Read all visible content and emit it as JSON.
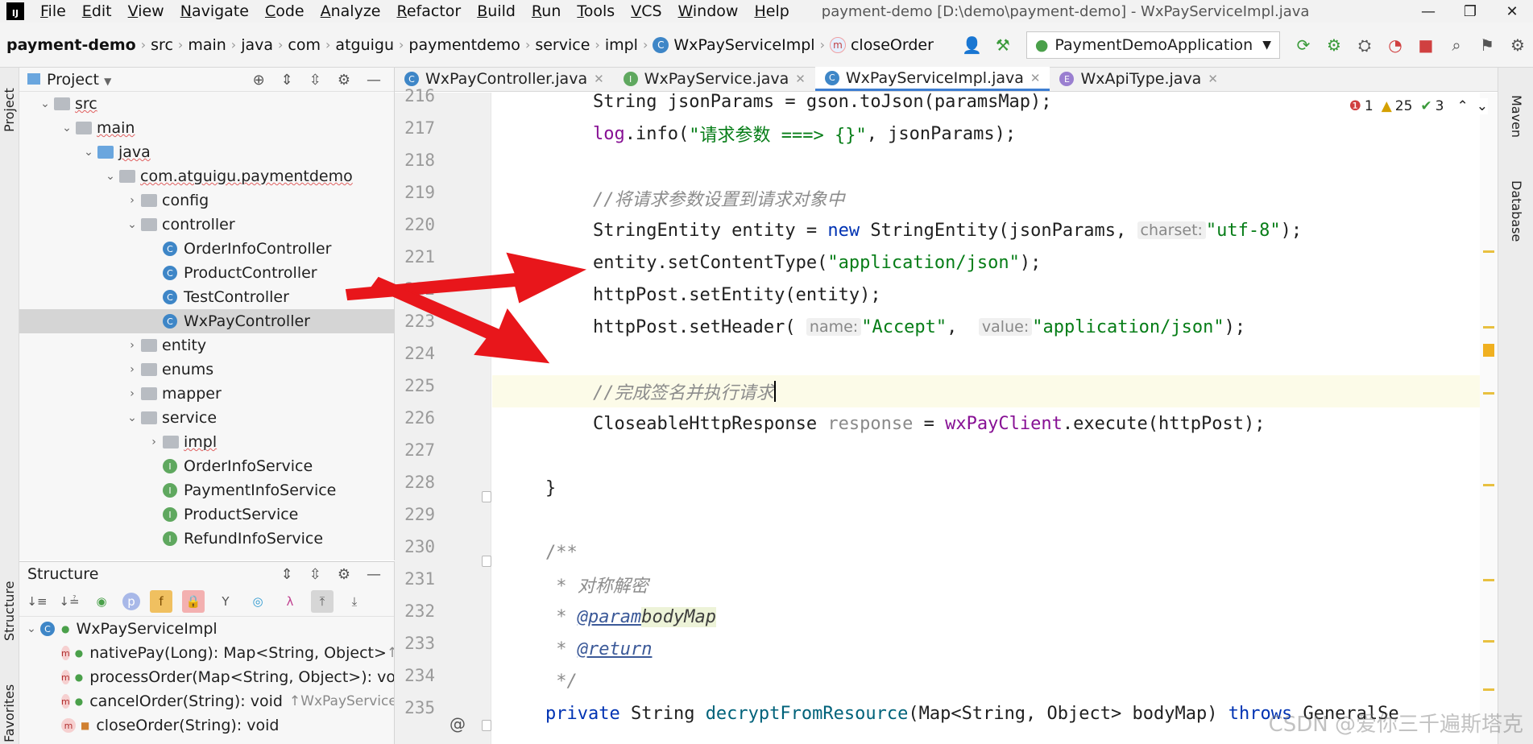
{
  "menubar": {
    "logo": "IJ",
    "items": [
      "File",
      "Edit",
      "View",
      "Navigate",
      "Code",
      "Analyze",
      "Refactor",
      "Build",
      "Run",
      "Tools",
      "VCS",
      "Window",
      "Help"
    ],
    "window_title": "payment-demo [D:\\demo\\payment-demo] - WxPayServiceImpl.java",
    "controls": [
      "—",
      "❐",
      "✕"
    ]
  },
  "breadcrumb": {
    "items": [
      "payment-demo",
      "src",
      "main",
      "java",
      "com",
      "atguigu",
      "paymentdemo",
      "service",
      "impl",
      "WxPayServiceImpl",
      "closeOrder"
    ]
  },
  "run_config": {
    "label": "PaymentDemoApplication"
  },
  "left_stripe": {
    "project": "Project",
    "structure": "Structure",
    "favorites": "Favorites"
  },
  "right_stripe": {
    "maven": "Maven",
    "database": "Database"
  },
  "project_panel": {
    "title": "Project",
    "tree": [
      {
        "label": "src",
        "indent": 1,
        "type": "folder",
        "open": true
      },
      {
        "label": "main",
        "indent": 2,
        "type": "folder",
        "open": true
      },
      {
        "label": "java",
        "indent": 3,
        "type": "folder-blue",
        "open": true
      },
      {
        "label": "com.atguigu.paymentdemo",
        "indent": 4,
        "type": "package",
        "open": true
      },
      {
        "label": "config",
        "indent": 5,
        "type": "package",
        "open": false
      },
      {
        "label": "controller",
        "indent": 5,
        "type": "package",
        "open": true
      },
      {
        "label": "OrderInfoController",
        "indent": 6,
        "type": "class"
      },
      {
        "label": "ProductController",
        "indent": 6,
        "type": "class"
      },
      {
        "label": "TestController",
        "indent": 6,
        "type": "class"
      },
      {
        "label": "WxPayController",
        "indent": 6,
        "type": "class",
        "selected": true
      },
      {
        "label": "entity",
        "indent": 5,
        "type": "package",
        "open": false
      },
      {
        "label": "enums",
        "indent": 5,
        "type": "package",
        "open": false
      },
      {
        "label": "mapper",
        "indent": 5,
        "type": "package",
        "open": false
      },
      {
        "label": "service",
        "indent": 5,
        "type": "package",
        "open": true
      },
      {
        "label": "impl",
        "indent": 6,
        "type": "package",
        "open": false
      },
      {
        "label": "OrderInfoService",
        "indent": 6,
        "type": "interface"
      },
      {
        "label": "PaymentInfoService",
        "indent": 6,
        "type": "interface"
      },
      {
        "label": "ProductService",
        "indent": 6,
        "type": "interface"
      },
      {
        "label": "RefundInfoService",
        "indent": 6,
        "type": "interface"
      }
    ]
  },
  "structure_panel": {
    "title": "Structure",
    "root": "WxPayServiceImpl",
    "members": [
      {
        "label": "nativePay(Long): Map<String, Object>",
        "suffix": "↑"
      },
      {
        "label": "processOrder(Map<String, Object>): vo",
        "suffix": ""
      },
      {
        "label": "cancelOrder(String): void",
        "suffix": "↑WxPayService"
      },
      {
        "label": "closeOrder(String): void",
        "suffix": ""
      }
    ]
  },
  "tabs": [
    {
      "label": "WxPayController.java",
      "icon": "C",
      "active": false
    },
    {
      "label": "WxPayService.java",
      "icon": "I",
      "active": false
    },
    {
      "label": "WxPayServiceImpl.java",
      "icon": "C",
      "active": true
    },
    {
      "label": "WxApiType.java",
      "icon": "E",
      "active": false
    }
  ],
  "inspection": {
    "errors": "1",
    "warnings": "25",
    "ok": "3"
  },
  "editor": {
    "line_numbers": [
      "216",
      "217",
      "218",
      "219",
      "220",
      "221",
      "222",
      "223",
      "224",
      "225",
      "226",
      "227",
      "228",
      "229",
      "230",
      "231",
      "232",
      "233",
      "234",
      "235"
    ],
    "lines": {
      "l216": "String jsonParams = gson.toJson(paramsMap);",
      "l217a": "log",
      "l217b": ".info(",
      "l217c": "\"请求参数 ===> {}\"",
      "l217d": ", jsonParams);",
      "l219": "//将请求参数设置到请求对象中",
      "l220a": "StringEntity entity = ",
      "l220b": "new",
      "l220c": " StringEntity(jsonParams, ",
      "l220hint": "charset:",
      "l220d": "\"utf-8\"",
      "l220e": ");",
      "l221a": "entity.setContentType(",
      "l221b": "\"application/json\"",
      "l221c": ");",
      "l222": "httpPost.setEntity(entity);",
      "l223a": "httpPost.setHeader( ",
      "l223hint1": "name:",
      "l223b": "\"Accept\"",
      "l223c": ",  ",
      "l223hint2": "value:",
      "l223d": "\"application/json\"",
      "l223e": ");",
      "l225": "//完成签名并执行请求",
      "l226a": "CloseableHttpResponse ",
      "l226b": "response",
      "l226c": " = ",
      "l226d": "wxPayClient",
      "l226e": ".execute(httpPost);",
      "l228": "}",
      "l230": "/**",
      "l231": " * 对称解密",
      "l232a": " * ",
      "l232b": "@param",
      "l232c": "bodyMap",
      "l233a": " * ",
      "l233b": "@return",
      "l234": " */",
      "l235a": "private",
      "l235b": " String ",
      "l235c": "decryptFromResource",
      "l235d": "(Map<String, Object> bodyMap) ",
      "l235e": "throws",
      "l235f": " GeneralSe"
    }
  },
  "watermark": "CSDN @爱你三千遍斯塔克",
  "colors": {
    "accent": "#3d7ed2",
    "arrow": "#e8161b",
    "keyword": "#0033b3",
    "string": "#067d17"
  }
}
